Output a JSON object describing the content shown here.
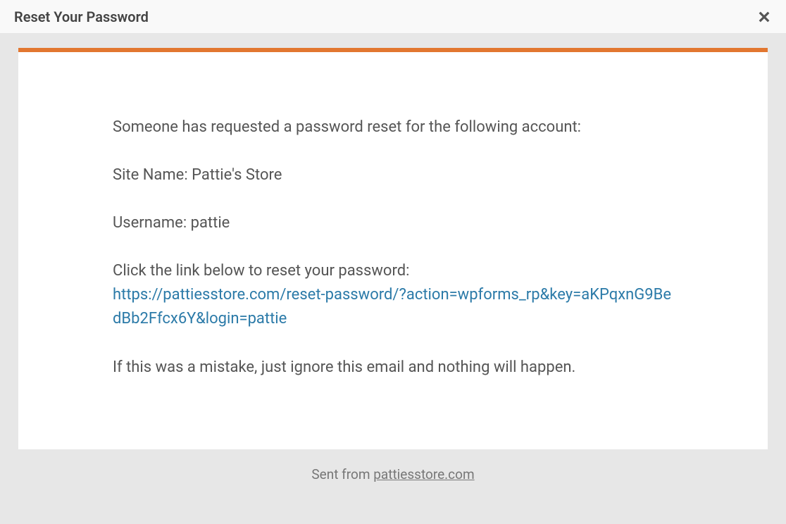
{
  "header": {
    "title": "Reset Your Password"
  },
  "email": {
    "intro": "Someone has requested a password reset for the following account:",
    "site_line": "Site Name: Pattie's Store",
    "username_line": "Username: pattie",
    "click_text": "Click the link below to reset your password:",
    "reset_url": "https://pattiesstore.com/reset-password/?action=wpforms_rp&key=aKPqxnG9BedBb2Ffcx6Y&login=pattie",
    "mistake_text": "If this was a mistake, just ignore this email and nothing will happen."
  },
  "footer": {
    "prefix": "Sent from ",
    "domain": "pattiesstore.com"
  },
  "colors": {
    "accent": "#e27730",
    "link": "#2b7aa8"
  }
}
